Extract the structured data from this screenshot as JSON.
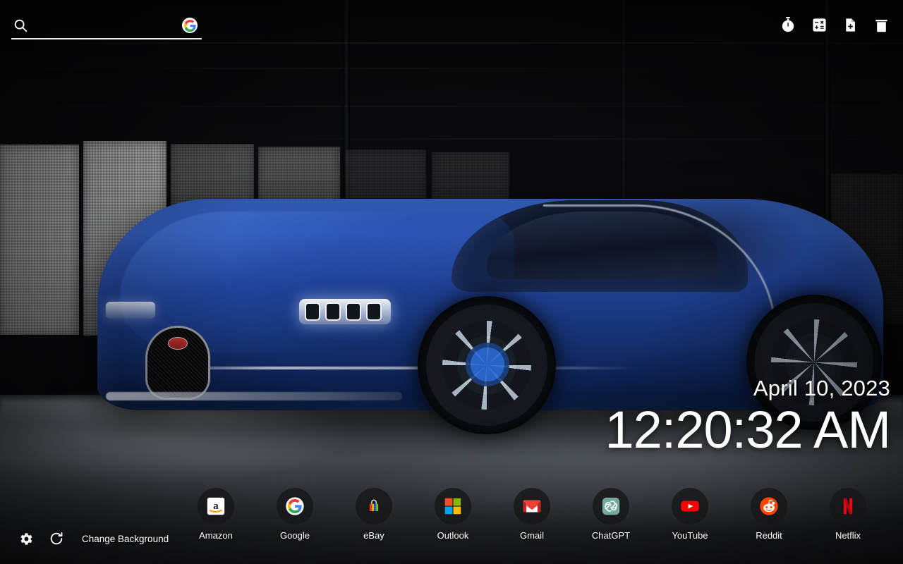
{
  "page": {
    "kind": "new-tab-page",
    "wallpaper_subject": "Blue Bugatti Chiron sports car in a dark studio"
  },
  "search": {
    "value": "",
    "placeholder": "",
    "icon": "search-icon",
    "engine_icon": "google-g-icon"
  },
  "tools": [
    {
      "name": "timer-icon",
      "label": "Timer",
      "glyph": "stopwatch"
    },
    {
      "name": "calculator-icon",
      "label": "Calculator",
      "glyph": "calculator"
    },
    {
      "name": "note-add-icon",
      "label": "New Note",
      "glyph": "note-plus"
    },
    {
      "name": "trash-icon",
      "label": "Trash",
      "glyph": "trash-can"
    }
  ],
  "clock": {
    "date": "April 10, 2023",
    "time": "12:20:32 AM"
  },
  "shortcuts": [
    {
      "label": "Amazon",
      "icon": "amazon-icon",
      "bg": "#ffffff"
    },
    {
      "label": "Google",
      "icon": "google-icon",
      "bg": "#ffffff"
    },
    {
      "label": "eBay",
      "icon": "ebay-icon",
      "bg": "#2b2b2e"
    },
    {
      "label": "Outlook",
      "icon": "outlook-icon",
      "bg": "#2b2b2e"
    },
    {
      "label": "Gmail",
      "icon": "gmail-icon",
      "bg": "#ffffff"
    },
    {
      "label": "ChatGPT",
      "icon": "chatgpt-icon",
      "bg": "#74aa9c"
    },
    {
      "label": "YouTube",
      "icon": "youtube-icon",
      "bg": "#ff0000"
    },
    {
      "label": "Reddit",
      "icon": "reddit-icon",
      "bg": "#ff4500"
    },
    {
      "label": "Netflix",
      "icon": "netflix-icon",
      "bg": "#2b2b2e"
    }
  ],
  "bottom_left": {
    "settings_icon": "gear-icon",
    "refresh_icon": "refresh-icon",
    "change_background_label": "Change Background"
  },
  "colors": {
    "text": "#ffffff",
    "car_blue": "#2a50a8",
    "google_blue": "#4285f4",
    "google_red": "#ea4335",
    "google_yellow": "#fbbc05",
    "google_green": "#34a853",
    "youtube_red": "#ff0000",
    "reddit_orange": "#ff4500",
    "netflix_red": "#e50914",
    "chatgpt_teal": "#74aa9c",
    "amazon_orange": "#ff9900"
  }
}
